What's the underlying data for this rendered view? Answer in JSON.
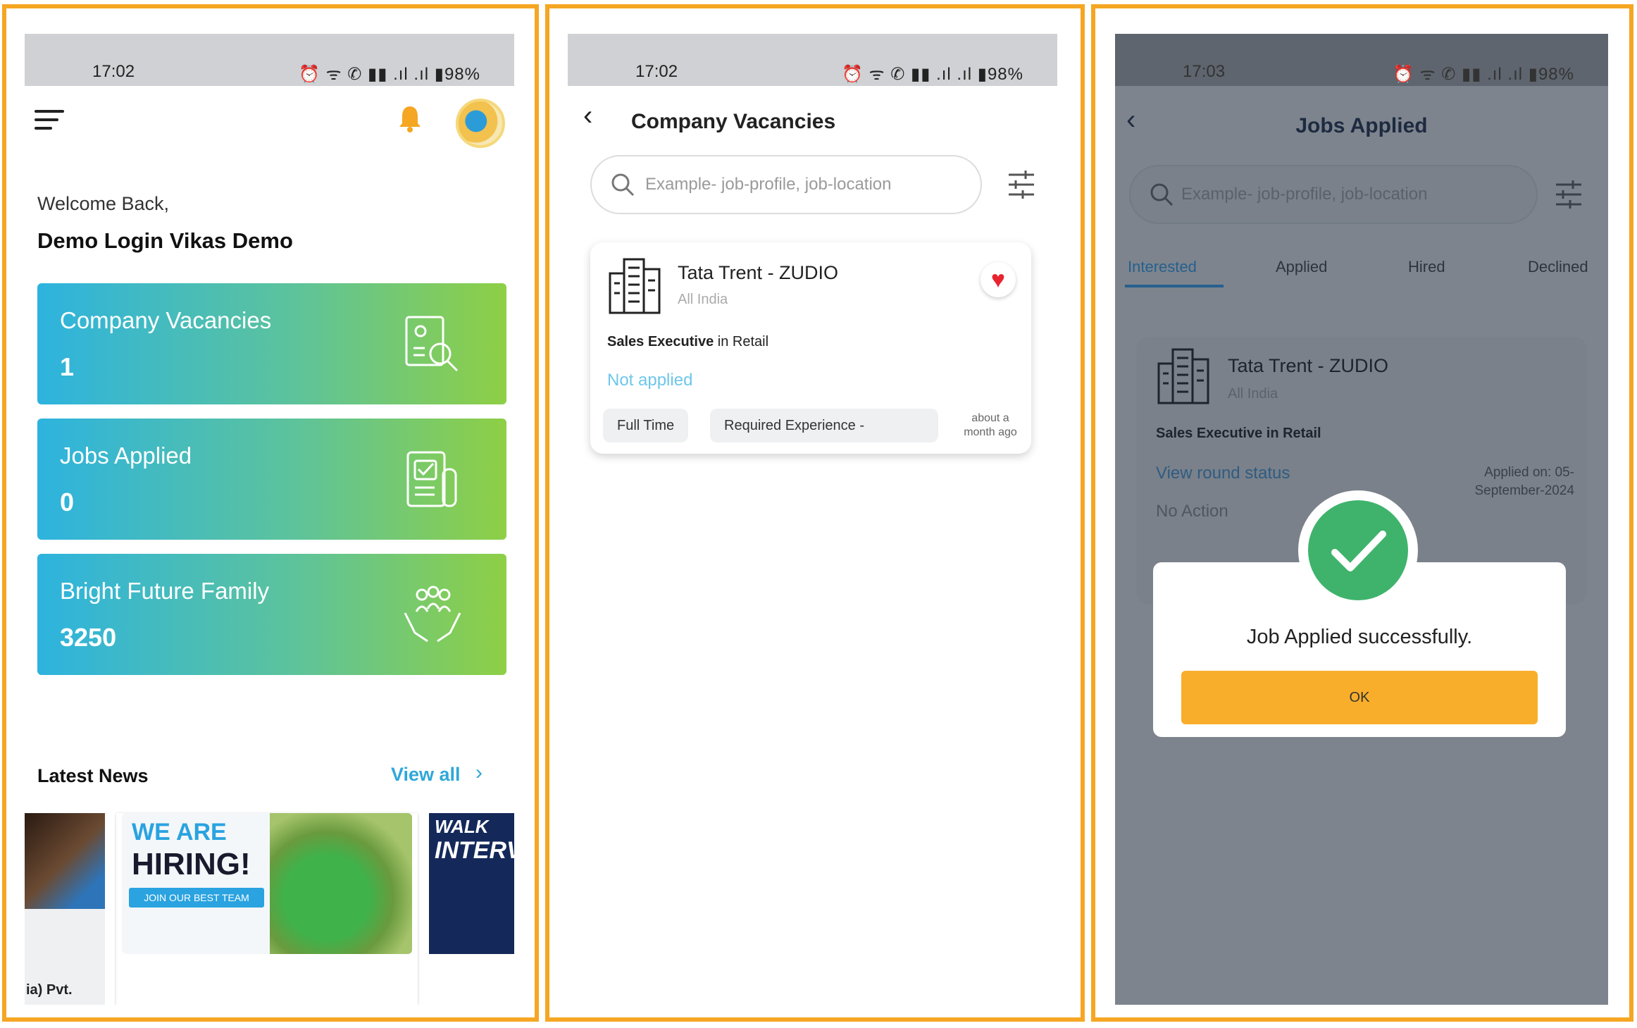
{
  "status_bar_1": {
    "time": "17:02",
    "icons": "⏰ ᯤ ✆ ▮▮ .ıl .ıl ▮98%"
  },
  "status_bar_2": {
    "time": "17:02",
    "icons": "⏰ ᯤ ✆ ▮▮ .ıl .ıl ▮98%"
  },
  "status_bar_3": {
    "time": "17:03",
    "icons": "⏰ ᯤ ✆ ▮▮ .ıl .ıl ▮98%"
  },
  "home": {
    "welcome": "Welcome Back,",
    "username": "Demo Login Vikas Demo",
    "cards": [
      {
        "title": "Company Vacancies",
        "value": "1",
        "icon": "search-document-icon"
      },
      {
        "title": "Jobs Applied",
        "value": "0",
        "icon": "checked-document-icon"
      },
      {
        "title": "Bright Future Family",
        "value": "3250",
        "icon": "family-hands-icon"
      }
    ],
    "news_title": "Latest News",
    "view_all": "View all",
    "news": [
      {
        "caption": "ia) Pvt."
      },
      {
        "line1": "WE ARE",
        "line2": "HIRING!",
        "join": "JOIN OUR BEST TEAM"
      },
      {
        "line1": "WALK",
        "line2": "INTERV"
      }
    ]
  },
  "vacancies": {
    "title": "Company Vacancies",
    "search_placeholder": "Example- job-profile, job-location",
    "job": {
      "company": "Tata Trent - ZUDIO",
      "location": "All India",
      "role": "Sales Executive",
      "role_in": "in Retail",
      "status": "Not applied",
      "chips": [
        "Full Time",
        "Required Experience -"
      ],
      "posted": "about a month ago"
    }
  },
  "applied": {
    "title": "Jobs Applied",
    "search_placeholder": "Example- job-profile, job-location",
    "tabs": [
      "Interested",
      "Applied",
      "Hired",
      "Declined"
    ],
    "job": {
      "company": "Tata Trent - ZUDIO",
      "location": "All India",
      "role": "Sales Executive in Retail",
      "view_status": "View round status",
      "applied_on": "Applied on: 05-September-2024",
      "action": "No Action"
    },
    "dialog": {
      "message": "Job Applied successfully.",
      "ok": "OK"
    }
  },
  "colors": {
    "accent": "#f5a623",
    "card_gradient_start": "#2db3df",
    "card_gradient_end": "#8ecf45",
    "success": "#3fb36c",
    "ok_button": "#f9ae2b"
  }
}
